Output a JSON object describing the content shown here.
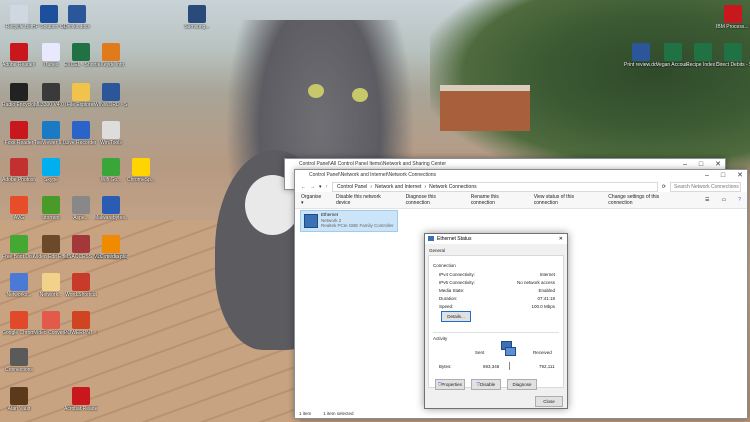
{
  "desktop_icons": [
    {
      "label": "Recycle Bin",
      "color": "#cfd8e0"
    },
    {
      "label": "HP Solution Center",
      "color": "#1c4f9c"
    },
    {
      "label": "Drinks.docx",
      "color": "#2b579a"
    },
    {
      "label": "Adobe Reader XI",
      "color": "#c8171d"
    },
    {
      "label": "iTunes",
      "color": "#e8e8ff"
    },
    {
      "label": "EXCEL - Shortcut",
      "color": "#207245"
    },
    {
      "label": "eXeyde info",
      "color": "#e07a1a"
    },
    {
      "label": "Radio Encycloped...",
      "color": "#222222"
    },
    {
      "label": "ML3300 V4.0 Installer",
      "color": "#3a3a3a"
    },
    {
      "label": "File Explorer",
      "color": "#f2c34a"
    },
    {
      "label": "WINWORD - Shortcut",
      "color": "#2b579a"
    },
    {
      "label": "Foxit Reader",
      "color": "#c8171d"
    },
    {
      "label": "TeeViewer 9.0 Ea...",
      "color": "#1a7ac4"
    },
    {
      "label": "Live Recorder",
      "color": "#2a64c8"
    },
    {
      "label": "Win.Tools",
      "color": "#dddddd"
    },
    {
      "label": "Adobe Photoshop...",
      "color": "#c23030"
    },
    {
      "label": "Skype",
      "color": "#00aff0"
    },
    {
      "label": "Wifi Go...",
      "color": "#3aa63a"
    },
    {
      "label": "ChromeSp...",
      "color": "#ffd400"
    },
    {
      "label": "AVG",
      "color": "#e84d2a"
    },
    {
      "label": "utorrent",
      "color": "#4a9a2a"
    },
    {
      "label": "Aspe...",
      "color": "#888888"
    },
    {
      "label": "Malwarebytes...",
      "color": "#2a5cb4"
    },
    {
      "label": "Free Boot Disk by Pa...",
      "color": "#44a832"
    },
    {
      "label": "Video Edit Effects",
      "color": "#6a4a2a"
    },
    {
      "label": "MSACCESS - Shortcut",
      "color": "#a4373a"
    },
    {
      "label": "VideoWidget - Shortcut",
      "color": "#3a8fd6"
    },
    {
      "label": "Networks...",
      "color": "#4a7ad6"
    },
    {
      "label": "Network...",
      "color": "#f2d18a"
    },
    {
      "label": "Word.Shortcut",
      "color": "#c83a2a"
    },
    {
      "label": "Google Chrome",
      "color": "#e04a2a"
    },
    {
      "label": "Video Converter",
      "color": "#e25a4a"
    },
    {
      "label": "POWERPNT - Shortcut",
      "color": "#d04423"
    },
    {
      "label": "Connections",
      "color": "#5a5a5a"
    },
    {
      "label": "VLC media player",
      "color": "#f08a00"
    },
    {
      "label": "Atari Vault",
      "color": "#5a3a1a"
    },
    {
      "label": "Acrobat Reader DC",
      "color": "#c8171d"
    },
    {
      "label": "Samsung...",
      "color": "#2a4a7a"
    },
    {
      "label": "Print review.docx",
      "color": "#2b579a"
    },
    {
      "label": "Vegan Accoun...",
      "color": "#207245"
    },
    {
      "label": "Recipe Index Shortcut",
      "color": "#207245"
    },
    {
      "label": "Direct Debits - Shortcut",
      "color": "#207245"
    },
    {
      "label": "IBM Process... - Shortcut",
      "color": "#c8171d"
    }
  ],
  "back_window": {
    "title": "Control Panel\\All Control Panel Items\\Network and Sharing Center"
  },
  "net_window": {
    "title": "Control Panel\\Network and Internet\\Network Connections",
    "breadcrumb": [
      "Control Panel",
      "Network and Internet",
      "Network Connections"
    ],
    "search_placeholder": "Search Network Connections",
    "toolbar": [
      "Organise ▾",
      "Disable this network device",
      "Diagnose this connection",
      "Rename this connection",
      "View status of this connection",
      "Change settings of this connection"
    ],
    "adapter": {
      "name": "Ethernet",
      "network": "Network 2",
      "device": "Realtek PCIe GBE Family Controller"
    },
    "status_left": "1 item",
    "status_selected": "1 item selected"
  },
  "dialog": {
    "title": "Ethernet Status",
    "tab": "General",
    "connection_label": "Connection",
    "rows": [
      {
        "k": "IPv4 Connectivity:",
        "v": "Internet"
      },
      {
        "k": "IPv6 Connectivity:",
        "v": "No network access"
      },
      {
        "k": "Media State:",
        "v": "Enabled"
      },
      {
        "k": "Duration:",
        "v": "07:41:18"
      },
      {
        "k": "Speed:",
        "v": "100.0 Mbps"
      }
    ],
    "details_btn": "Details...",
    "activity_label": "Activity",
    "sent_label": "Sent",
    "received_label": "Received",
    "bytes_label": "Bytes:",
    "bytes_sent": "693,346",
    "bytes_received": "792,111",
    "properties_btn": "Properties",
    "disable_btn": "Disable",
    "diagnose_btn": "Diagnose",
    "close_btn": "Close"
  }
}
